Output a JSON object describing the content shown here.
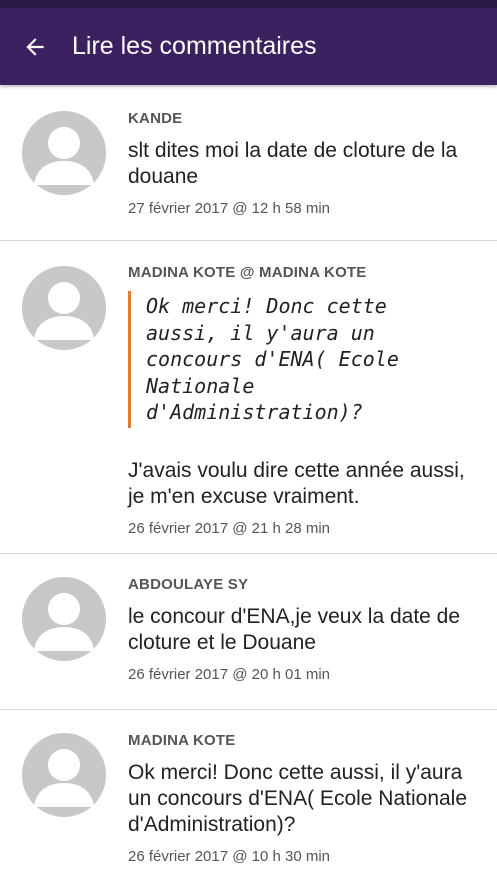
{
  "header": {
    "title": "Lire les commentaires"
  },
  "comments": [
    {
      "author": "KANDE",
      "text": "slt dites moi la date de cloture de la douane",
      "date": "27 février 2017 @ 12 h 58 min"
    },
    {
      "author": "MADINA KOTE @ MADINA KOTE",
      "quote": "Ok merci! Donc cette aussi, il y'aura un concours d'ENA( Ecole Nationale d'Administration)?",
      "text": "J'avais voulu dire cette année aussi, je m'en excuse vraiment.",
      "date": "26 février 2017 @ 21 h 28 min"
    },
    {
      "author": "ABDOULAYE SY",
      "text": "le concour d'ENA,je veux la date de cloture et le Douane",
      "date": "26 février 2017 @ 20 h 01 min"
    },
    {
      "author": "MADINA KOTE",
      "text": "Ok merci! Donc cette aussi, il y'aura un concours d'ENA( Ecole Nationale d'Administration)?",
      "date": "26 février 2017 @ 10 h 30 min"
    }
  ]
}
